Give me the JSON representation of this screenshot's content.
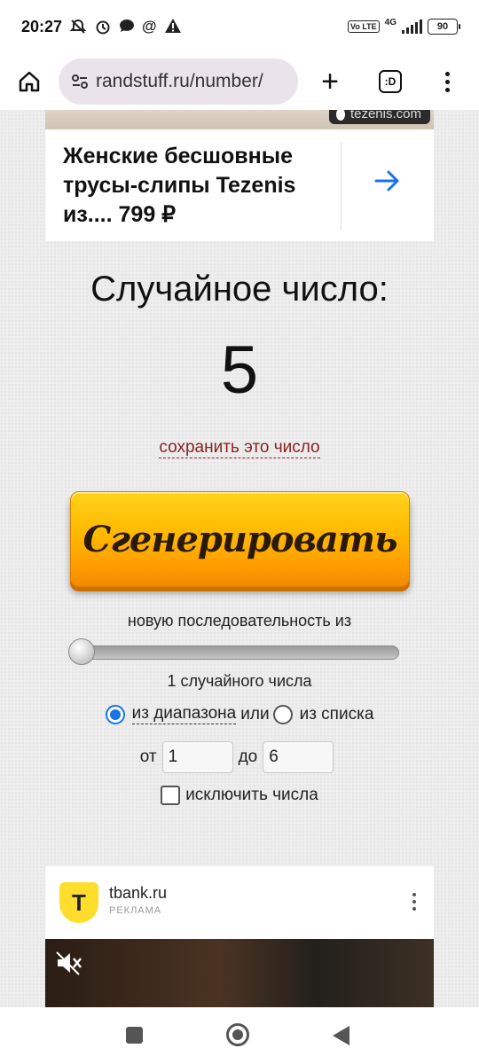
{
  "status_bar": {
    "time": "20:27",
    "network": "4G",
    "volte": "Vo LTE",
    "battery": "90"
  },
  "browser": {
    "url": "randstuff.ru/number/",
    "tabs_label": ":D"
  },
  "ad_top": {
    "brand": "tezenis.com",
    "title": "Женские бесшовные трусы-слипы Tezenis из.... 799 ₽",
    "arrow_color": "#1a73e8"
  },
  "main": {
    "label": "Случайное число:",
    "value": "5",
    "save_link": "сохранить это число",
    "generate_label": "Сгенерировать",
    "sequence_text": "новую последовательность из",
    "count_text": "1 случайного числа",
    "mode_range": "из диапазона",
    "mode_or": "или",
    "mode_list": "из списка",
    "mode_selected": "range",
    "from_label": "от",
    "from_value": "1",
    "to_label": "до",
    "to_value": "6",
    "exclude_label": "исключить числа",
    "exclude_checked": false,
    "slider_value": 1
  },
  "ad_bottom": {
    "logo_letter": "T",
    "domain": "tbank.ru",
    "label": "РЕКЛАМА"
  }
}
